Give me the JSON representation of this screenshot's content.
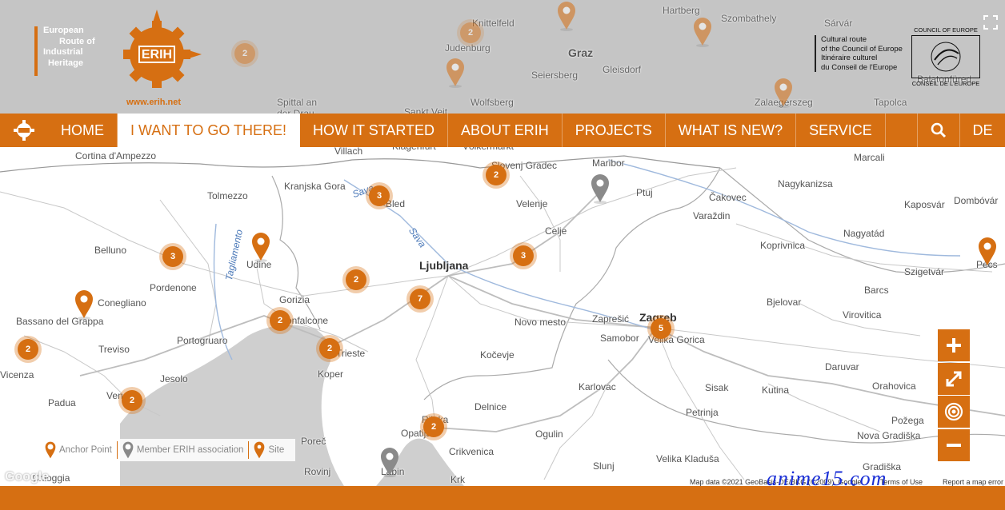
{
  "header": {
    "logo_lines": [
      "European",
      "Route of",
      "Industrial",
      "Heritage"
    ],
    "gear_text": "ERIH",
    "url": "www.erih.net",
    "coe_lines": [
      "Cultural route",
      "of the Council of Europe",
      "Itinéraire culturel",
      "du Conseil de l'Europe"
    ],
    "coe_logo_top": "COUNCIL OF EUROPE",
    "coe_logo_bottom": "CONSEIL DE L'EUROPE"
  },
  "nav": {
    "items": [
      "HOME",
      "I WANT TO GO THERE!",
      "HOW IT STARTED",
      "ABOUT ERIH",
      "PROJECTS",
      "WHAT IS NEW?",
      "SERVICE"
    ],
    "active_index": 1,
    "lang": "DE"
  },
  "map": {
    "place_labels": [
      "Villach",
      "Klagenfurt",
      "Völkermarkt",
      "Slovenj Gradec",
      "Maribor",
      "Ptuj",
      "Cortina d'Ampezzo",
      "Kranjska Gora",
      "Bled",
      "Velenje",
      "Čakovec",
      "Varaždin",
      "Nagykanizsa",
      "Marcali",
      "Dombóvár",
      "Kaposvár",
      "Tolmezzo",
      "Celje",
      "Koprivnica",
      "Nagyatád",
      "Belluno",
      "Udine",
      "Ljubljana",
      "Szigetvár",
      "Pécs",
      "Pordenone",
      "Conegliano",
      "Gorizia",
      "Monfalcone",
      "Novo mesto",
      "Zaprešić",
      "Zagreb",
      "Bjelovar",
      "Barcs",
      "Virovitica",
      "Bassano del Grappa",
      "Treviso",
      "Portogruaro",
      "Trieste",
      "Samobor",
      "Velika Gorica",
      "Koper",
      "Kočevje",
      "Jesolo",
      "Vicenza",
      "Venezia",
      "Padua",
      "Karlovac",
      "Sisak",
      "Kutina",
      "Daruvar",
      "Orahovica",
      "Delnice",
      "Rijeka",
      "Opatija",
      "Ogulin",
      "Petrinja",
      "Požega",
      "Poreč",
      "Crikvenica",
      "Slunj",
      "Velika Kladuša",
      "Nova Gradiška",
      "Rovinj",
      "Labin",
      "Krk",
      "Chioggia",
      "Gradiška",
      "Knittelfeld",
      "Judenburg",
      "Graz",
      "Hartberg",
      "Szombathely",
      "Gleisdorf",
      "Sárvár",
      "Seiersberg",
      "Wolfsberg",
      "Spittal an der Drau",
      "Zalaegerszeg",
      "Tapolca",
      "Balatonfüred",
      "Sankt Veit"
    ],
    "rivers": [
      "Sava",
      "Sava",
      "Tagliamento"
    ],
    "clusters": [
      {
        "count": 2
      },
      {
        "count": 3
      },
      {
        "count": 3
      },
      {
        "count": 3
      },
      {
        "count": 2
      },
      {
        "count": 7
      },
      {
        "count": 2
      },
      {
        "count": 5
      },
      {
        "count": 2
      },
      {
        "count": 2
      },
      {
        "count": 2
      },
      {
        "count": 2
      },
      {
        "count": 2
      },
      {
        "count": 2
      }
    ],
    "pins": [
      "site",
      "site",
      "member",
      "site",
      "member",
      "site",
      "site",
      "site",
      "site"
    ]
  },
  "legend": {
    "items": [
      {
        "icon": "anchor-point-pin-icon",
        "label": "Anchor Point"
      },
      {
        "icon": "member-pin-icon",
        "label": "Member ERIH association"
      },
      {
        "icon": "site-pin-icon",
        "label": "Site"
      }
    ]
  },
  "attribution": {
    "google": "Google",
    "map_data": "Map data ©2021 GeoBasis-DE/BKG (©2009), Google",
    "terms": "Terms of Use",
    "report": "Report a map error"
  },
  "watermark": "anime15.com",
  "colors": {
    "accent": "#d66f12",
    "river": "#4a78b8",
    "sea": "#cfcfcf",
    "land": "#ffffff"
  }
}
